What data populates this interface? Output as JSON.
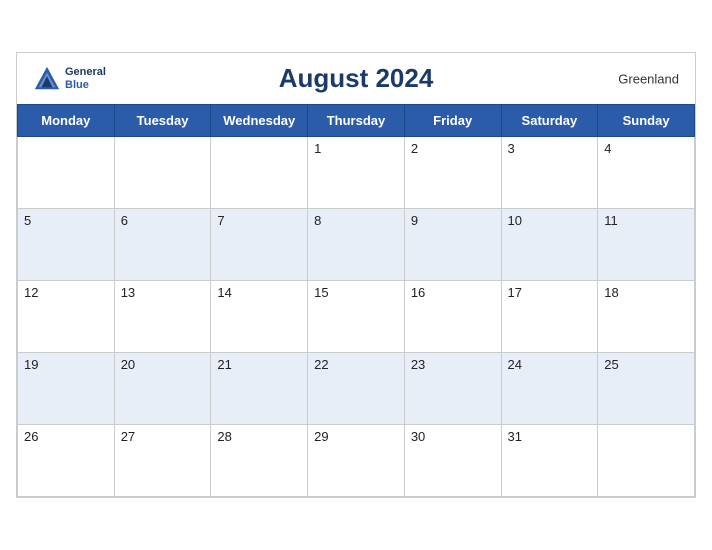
{
  "header": {
    "title": "August 2024",
    "region": "Greenland",
    "logo_general": "General",
    "logo_blue": "Blue"
  },
  "weekdays": [
    "Monday",
    "Tuesday",
    "Wednesday",
    "Thursday",
    "Friday",
    "Saturday",
    "Sunday"
  ],
  "weeks": [
    [
      "",
      "",
      "",
      "1",
      "2",
      "3",
      "4"
    ],
    [
      "5",
      "6",
      "7",
      "8",
      "9",
      "10",
      "11"
    ],
    [
      "12",
      "13",
      "14",
      "15",
      "16",
      "17",
      "18"
    ],
    [
      "19",
      "20",
      "21",
      "22",
      "23",
      "24",
      "25"
    ],
    [
      "26",
      "27",
      "28",
      "29",
      "30",
      "31",
      ""
    ]
  ]
}
